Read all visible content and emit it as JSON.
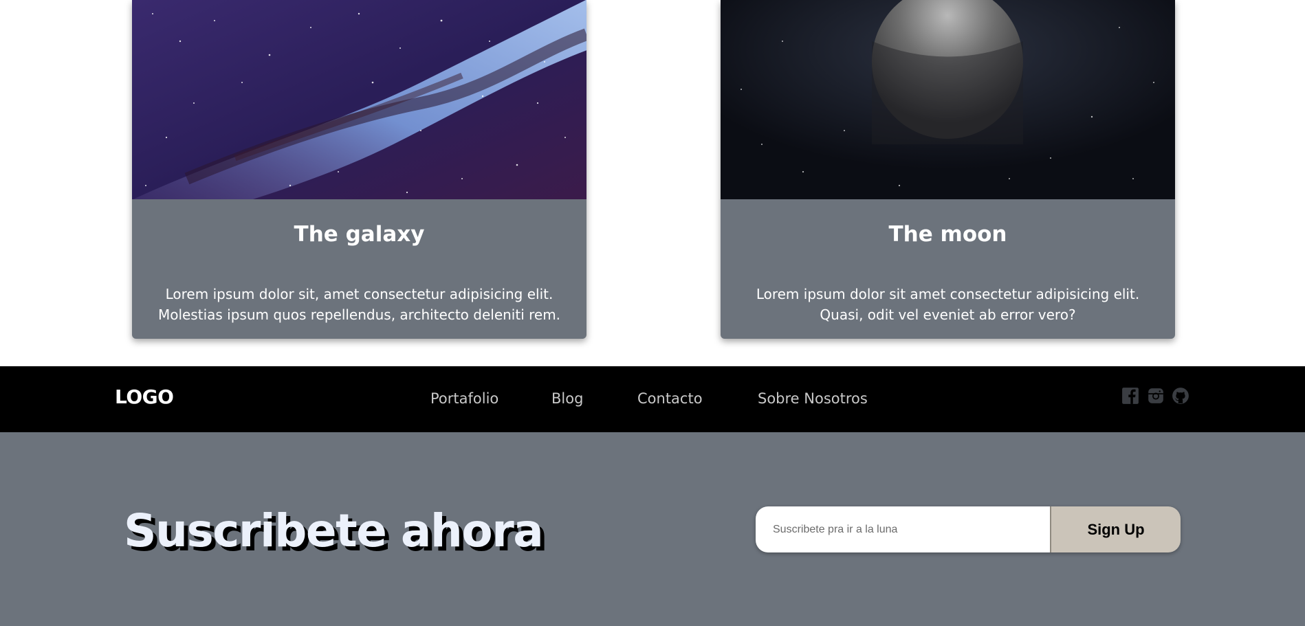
{
  "cards": [
    {
      "title": "The galaxy",
      "text": "Lorem ipsum dolor sit, amet consectetur adipisicing elit. Molestias ipsum quos repellendus, architecto deleniti rem.",
      "image": "galaxy-image"
    },
    {
      "title": "The moon",
      "text": "Lorem ipsum dolor sit amet consectetur adipisicing elit. Quasi, odit vel eveniet ab error vero?",
      "image": "moon-image"
    }
  ],
  "navbar": {
    "logo": "LOGO",
    "links": [
      "Portafolio",
      "Blog",
      "Contacto",
      "Sobre Nosotros"
    ],
    "social_icons": [
      "facebook-icon",
      "instagram-icon",
      "github-icon"
    ]
  },
  "subscribe": {
    "title": "Suscribete ahora",
    "input_placeholder": "Suscribete pra ir a la luna",
    "button_label": "Sign Up"
  },
  "colors": {
    "card_bg": "#6c737c",
    "navbar_bg": "#000000",
    "subscribe_bg": "#6c737c",
    "button_bg": "#cbc4b9",
    "title_text": "#ecf1fb"
  }
}
